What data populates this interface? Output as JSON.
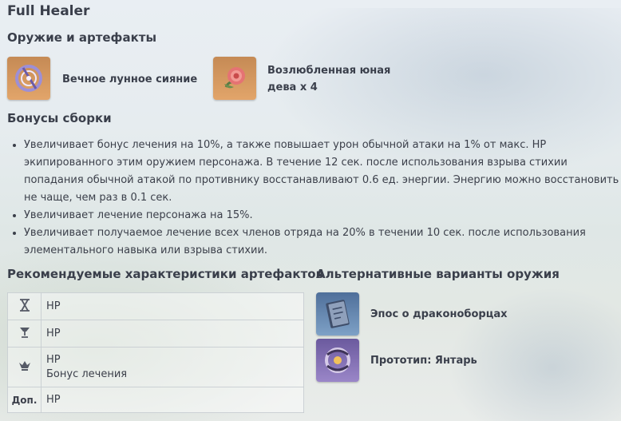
{
  "title": "Full Healer",
  "weapons_section": {
    "heading": "Оружие и артефакты",
    "items": [
      {
        "name": "Вечное лунное сияние",
        "icon": "moon-ring-icon"
      },
      {
        "name_line1": "Возлюбленная юная",
        "name_line2": "дева x 4",
        "icon": "rose-flower-icon"
      }
    ]
  },
  "bonuses_section": {
    "heading": "Бонусы сборки",
    "items": [
      "Увеличивает бонус лечения на 10%, а также повышает урон обычной атаки на 1% от макс. HP экипированного этим оружием персонажа. В течение 12 сек. после использования взрыва стихии попадания обычной атакой по противнику восстанавливают 0.6 ед. энергии. Энергию можно восстановить не чаще, чем раз в 0.1 сек.",
      "Увеличивает лечение персонажа на 15%.",
      "Увеличивает получаемое лечение всех членов отряда на 20% в течении 10 сек. после использования элементального навыка или взрыва стихии."
    ]
  },
  "stats_section": {
    "heading": "Рекомендуемые характеристики артефактов",
    "rows": [
      {
        "slot_icon": "hourglass-icon",
        "values": [
          "HP"
        ]
      },
      {
        "slot_icon": "goblet-icon",
        "values": [
          "HP"
        ]
      },
      {
        "slot_icon": "crown-icon",
        "values": [
          "HP",
          "Бонус лечения"
        ]
      },
      {
        "slot_label": "Доп.",
        "values": [
          "HP"
        ]
      }
    ]
  },
  "alternatives_section": {
    "heading": "Альтернативные варианты оружия",
    "items": [
      {
        "name": "Эпос о драконоборцах",
        "icon": "book-icon"
      },
      {
        "name": "Прототип: Янтарь",
        "icon": "ring-catalyst-icon"
      }
    ]
  },
  "colors": {
    "text": "#3b3f4a",
    "icon_orange": "#d9995e",
    "icon_purple": "#7d6bb0",
    "icon_blue": "#5f82ae"
  }
}
